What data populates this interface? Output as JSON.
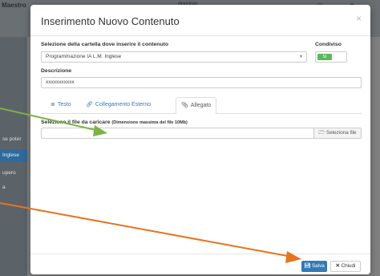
{
  "background": {
    "topbar_texts": [
      "Maestro",
      "dominio"
    ],
    "sidebar_items": [
      "se poter",
      "Inglese",
      "upero",
      "a"
    ],
    "sidebar_active_index": 1
  },
  "modal": {
    "title": "Inserimento Nuovo Contenuto",
    "close_symbol": "×",
    "folder_label": "Selezione della cartella dove inserire il contenuto",
    "folder_value": "Programmazione IA L.M. Inglese",
    "shared_label": "Condiviso",
    "shared_toggle_text": "SI",
    "description_label": "Descrizione",
    "description_value": "xxxxxxxxxxx",
    "tabs": [
      {
        "label": "Testo",
        "icon": "text-icon"
      },
      {
        "label": "Collegamento Esterno",
        "icon": "link-icon"
      },
      {
        "label": "Allegato",
        "icon": "paperclip-icon"
      }
    ],
    "active_tab": "Allegato",
    "file_label": "Selezione il file da caricare",
    "file_label_note": "(Dimensione massima del file 10Mb)",
    "file_button_label": "Seleziona file",
    "save_label": "Salva",
    "close_label": "Chiudi"
  },
  "annotation_colors": {
    "green_arrow": "#7cb342",
    "orange_arrow": "#e8741c"
  }
}
